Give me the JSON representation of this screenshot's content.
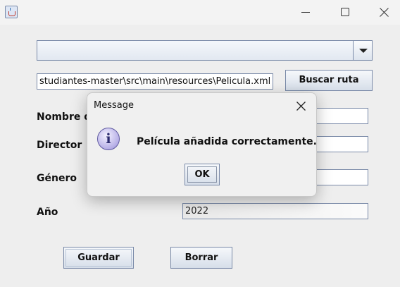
{
  "window": {
    "icon": "java-cup-icon",
    "controls": [
      "minimize-icon",
      "maximize-icon",
      "close-icon"
    ]
  },
  "form": {
    "combo_value": "",
    "path_value": "studiantes-master\\src\\main\\resources\\Pelicula.xml",
    "buscar_label": "Buscar ruta",
    "nombre_label": "Nombre de",
    "director_label": "Director",
    "genero_label": "Género",
    "anio_label": "Año",
    "nombre_value": "",
    "director_value": "",
    "genero_value": "",
    "anio_value": "2022",
    "guardar_label": "Guardar",
    "borrar_label": "Borrar"
  },
  "dialog": {
    "title": "Message",
    "message": "Película añadida correctamente.",
    "ok_label": "OK",
    "icon": "info-icon",
    "icon_glyph": "i"
  }
}
